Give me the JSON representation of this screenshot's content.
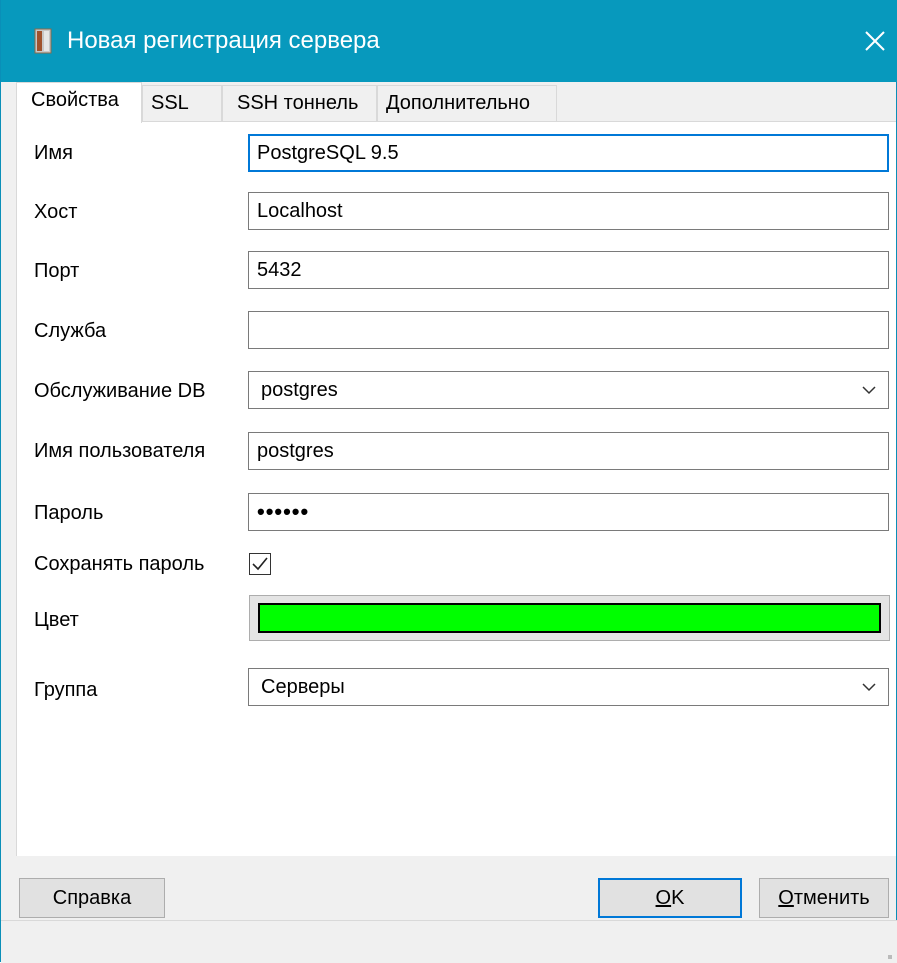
{
  "window": {
    "title": "Новая регистрация сервера",
    "accent": "#0799bd",
    "title_icon": "server-icon",
    "close_icon": "close-icon"
  },
  "tabs": [
    {
      "label": "Свойства",
      "active": true
    },
    {
      "label": "SSL",
      "active": false
    },
    {
      "label": "SSH тоннель",
      "active": false
    },
    {
      "label": "Дополнительно",
      "active": false
    }
  ],
  "form": {
    "name": {
      "label": "Имя",
      "value": "PostgreSQL 9.5"
    },
    "host": {
      "label": "Хост",
      "value": "Localhost"
    },
    "port": {
      "label": "Порт",
      "value": "5432"
    },
    "service": {
      "label": "Служба",
      "value": ""
    },
    "maintenance_db": {
      "label": "Обслуживание DB",
      "value": "postgres"
    },
    "username": {
      "label": "Имя пользователя",
      "value": "postgres"
    },
    "password": {
      "label": "Пароль",
      "value": "••••••"
    },
    "save_password": {
      "label": "Сохранять пароль",
      "checked": true
    },
    "color": {
      "label": "Цвет",
      "value": "#00ff00"
    },
    "group": {
      "label": "Группа",
      "value": "Серверы"
    }
  },
  "buttons": {
    "help": "Справка",
    "ok_mnemonic": "O",
    "ok_rest": "K",
    "cancel_mnemonic": "О",
    "cancel_rest": "тменить"
  }
}
